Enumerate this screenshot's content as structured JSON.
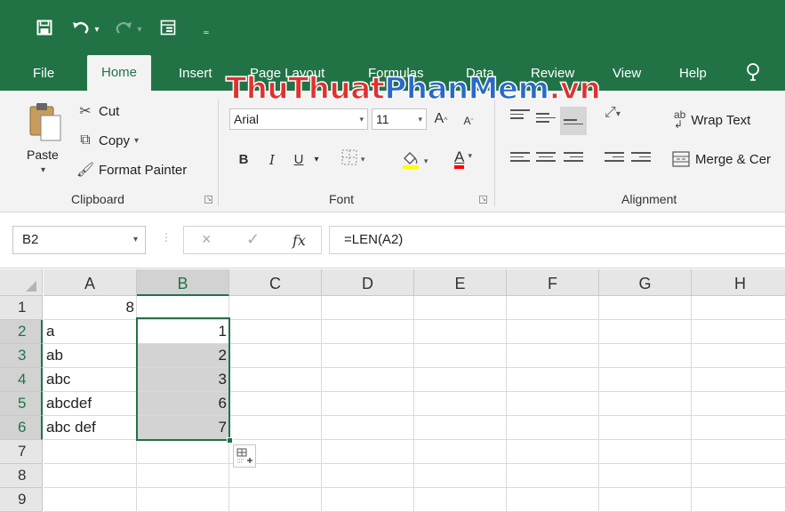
{
  "quick_access": {
    "save_icon": "save-icon",
    "undo_icon": "undo-icon",
    "redo_icon": "redo-icon",
    "form_icon": "form-icon",
    "customize_icon": "customize-icon"
  },
  "tabs": [
    "File",
    "Home",
    "Insert",
    "Page Layout",
    "Formulas",
    "Data",
    "Review",
    "View",
    "Help"
  ],
  "active_tab": "Home",
  "watermark": {
    "part1": "ThuThuat",
    "part2": "PhanMem",
    "part3": ".vn"
  },
  "clipboard": {
    "label": "Clipboard",
    "paste": "Paste",
    "cut": "Cut",
    "copy": "Copy",
    "format_painter": "Format Painter"
  },
  "font": {
    "label": "Font",
    "name": "Arial",
    "size": "11",
    "bold": "B",
    "italic": "I",
    "underline": "U",
    "grow": "A",
    "shrink": "A",
    "font_color_letter": "A"
  },
  "alignment": {
    "label": "Alignment",
    "wrap_text": "Wrap Text",
    "merge_center": "Merge & Cer"
  },
  "formula_bar": {
    "name_box": "B2",
    "cancel": "×",
    "enter": "✓",
    "fx": "fx",
    "formula": "=LEN(A2)"
  },
  "sheet": {
    "columns": [
      "A",
      "B",
      "C",
      "D",
      "E",
      "F",
      "G",
      "H"
    ],
    "selected_column": "B",
    "rows": [
      {
        "n": "1",
        "a": "",
        "a_num": "8",
        "b": ""
      },
      {
        "n": "2",
        "a": "a",
        "a_num": "",
        "b": "1"
      },
      {
        "n": "3",
        "a": "ab",
        "a_num": "",
        "b": "2"
      },
      {
        "n": "4",
        "a": "abc",
        "a_num": "",
        "b": "3"
      },
      {
        "n": "5",
        "a": "abcdef",
        "a_num": "",
        "b": "6"
      },
      {
        "n": "6",
        "a": "abc def",
        "a_num": "",
        "b": "7"
      },
      {
        "n": "7",
        "a": "",
        "a_num": "",
        "b": ""
      },
      {
        "n": "8",
        "a": "",
        "a_num": "",
        "b": ""
      },
      {
        "n": "9",
        "a": "",
        "a_num": "",
        "b": ""
      }
    ]
  },
  "colors": {
    "excel_green": "#217346",
    "ribbon_bg": "#f3f3f3",
    "selection_fill": "#d3d3d3",
    "watermark_red": "#e42f2f",
    "watermark_blue": "#2a69c7"
  }
}
